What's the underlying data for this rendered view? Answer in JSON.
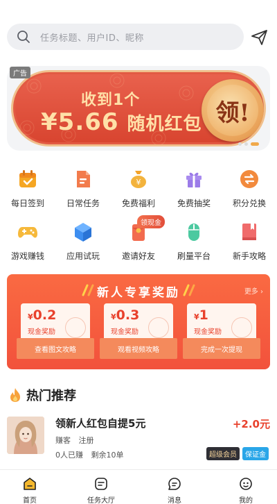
{
  "search": {
    "placeholder": "任务标题、用户ID、昵称",
    "search_icon": "search-icon",
    "send_icon": "send-icon"
  },
  "banner": {
    "ad_tag": "广告",
    "line1": "收到1个",
    "amount": "¥5.66",
    "line2_text": "随机红包",
    "circle_text": "领!",
    "slide_count": 3,
    "active_slide": 2
  },
  "grid": [
    {
      "label": "每日签到",
      "icon": "calendar-check-icon",
      "color": "#f5a623"
    },
    {
      "label": "日常任务",
      "icon": "document-icon",
      "color": "#f27b4c"
    },
    {
      "label": "免费福利",
      "icon": "money-bag-icon",
      "color": "#f3b33d"
    },
    {
      "label": "免费抽奖",
      "icon": "gift-icon",
      "color": "#9b7be8"
    },
    {
      "label": "积分兑换",
      "icon": "exchange-icon",
      "color": "#f28a3d"
    },
    {
      "label": "游戏赚钱",
      "icon": "gamepad-icon",
      "color": "#f6b93b"
    },
    {
      "label": "应用试玩",
      "icon": "cube-icon",
      "color": "#3d8ef0"
    },
    {
      "label": "邀请好友",
      "icon": "red-envelope-icon",
      "color": "#f26b4e"
    },
    {
      "label": "刷量平台",
      "icon": "mouse-icon",
      "color": "#4cc9a0"
    },
    {
      "label": "新手攻略",
      "icon": "book-icon",
      "color": "#f06b6b"
    }
  ],
  "grid_badge": "领现金",
  "newcomer": {
    "title": "新人专享奖励",
    "more": "更多 ›",
    "coupons": [
      {
        "currency": "¥",
        "amount": "0.2",
        "caption": "现金奖励",
        "action": "查看图文攻略"
      },
      {
        "currency": "¥",
        "amount": "0.3",
        "caption": "现金奖励",
        "action": "观看视频攻略"
      },
      {
        "currency": "¥",
        "amount": "1",
        "caption": "现金奖励",
        "action": "完成一次提现"
      }
    ]
  },
  "hot": {
    "title": "热门推荐",
    "items": [
      {
        "title": "领新人红包自提5元",
        "price": "+2.0元",
        "tags": [
          "赚客",
          "注册"
        ],
        "stats": [
          "0人已赚",
          "剩余10单"
        ],
        "badges": [
          "超级会员",
          "保证金"
        ]
      }
    ]
  },
  "tabs": [
    {
      "label": "首页",
      "icon": "home-icon",
      "active": true
    },
    {
      "label": "任务大厅",
      "icon": "task-hall-icon",
      "active": false
    },
    {
      "label": "消息",
      "icon": "message-icon",
      "active": false
    },
    {
      "label": "我的",
      "icon": "profile-icon",
      "active": false
    }
  ],
  "colors": {
    "accent_red": "#e8412c",
    "banner_red": "#d8442f",
    "gold": "#f0a94b",
    "newcomer_bg": "#f2523c"
  }
}
